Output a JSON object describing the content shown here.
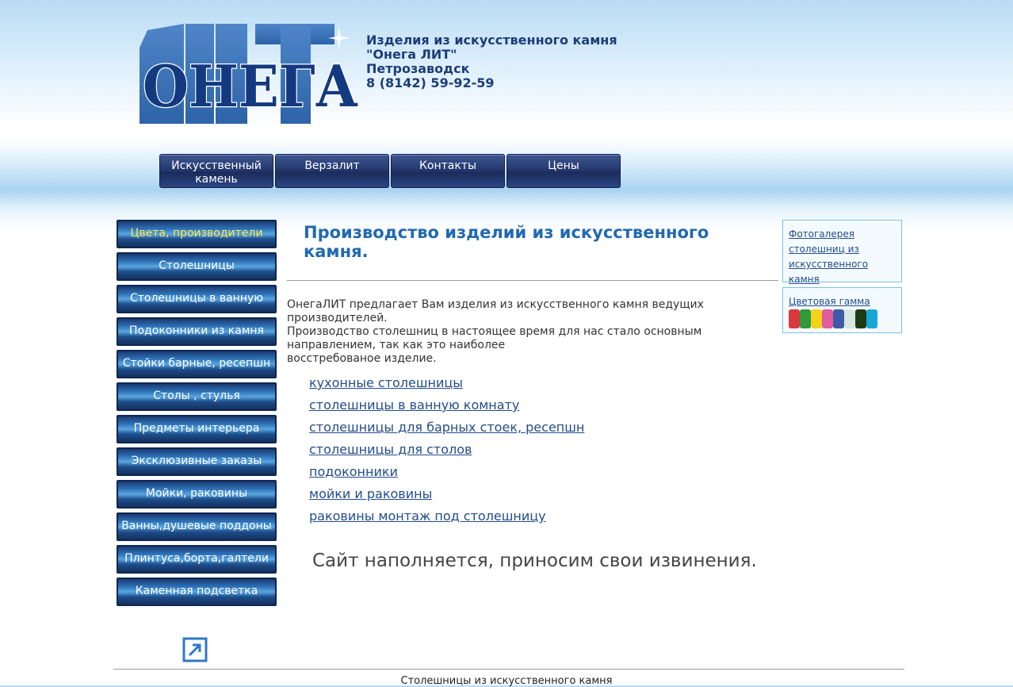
{
  "header": {
    "logo_text": "ОНЕГА ЛИТ",
    "company_lines": [
      "Изделия из искусственного камня",
      "\"Онега ЛИТ\"",
      "Петрозаводск",
      "8 (8142) 59-92-59"
    ]
  },
  "topnav": [
    {
      "label": "Искусственный камень"
    },
    {
      "label": "Верзалит"
    },
    {
      "label": "Контакты"
    },
    {
      "label": "Цены"
    }
  ],
  "leftmenu": [
    {
      "label": "Цвета, производители"
    },
    {
      "label": "Столешницы"
    },
    {
      "label": "Столешницы в ванную"
    },
    {
      "label": "Подоконники из камня"
    },
    {
      "label": "Стойки барные, ресепшн"
    },
    {
      "label": "Столы , стулья"
    },
    {
      "label": "Предметы интерьера"
    },
    {
      "label": "Эксклюзивные заказы"
    },
    {
      "label": "Мойки, раковины"
    },
    {
      "label": "Ванны,душевые поддоны"
    },
    {
      "label": "Плинтуса,борта,галтели"
    },
    {
      "label": "Каменная подсветка"
    }
  ],
  "main": {
    "title": "Производство изделий из искусственного камня.",
    "intro_lines": [
      "ОнегаЛИТ предлагает Вам изделия из искусственного камня ведущих",
      "производителей.",
      "Производство столешниц в настоящее время для нас стало основным",
      "направлением, так как это наиболее",
      "восстребованое изделие."
    ],
    "links": [
      "кухонные столешницы",
      "столешницы в ванную комнату",
      "столешницы для барных стоек, ресепшн",
      "столешницы для столов",
      "подоконники",
      "мойки и раковины",
      "раковины монтаж под столешницу"
    ],
    "notice": "Сайт наполняется, приносим свои извинения."
  },
  "sidebar_right": {
    "gallery_link": "Фотогалерея столешниц из искусственного камня",
    "palette_link": "Цветовая гамма",
    "palette_colors": [
      "#d8383e",
      "#2e9a3c",
      "#f4d21c",
      "#e25aa0",
      "#3f5aa6",
      "#d6e8e0",
      "#1d3a14",
      "#18a8d8"
    ]
  },
  "footer": {
    "text": "Столешницы из искусственного камня"
  }
}
